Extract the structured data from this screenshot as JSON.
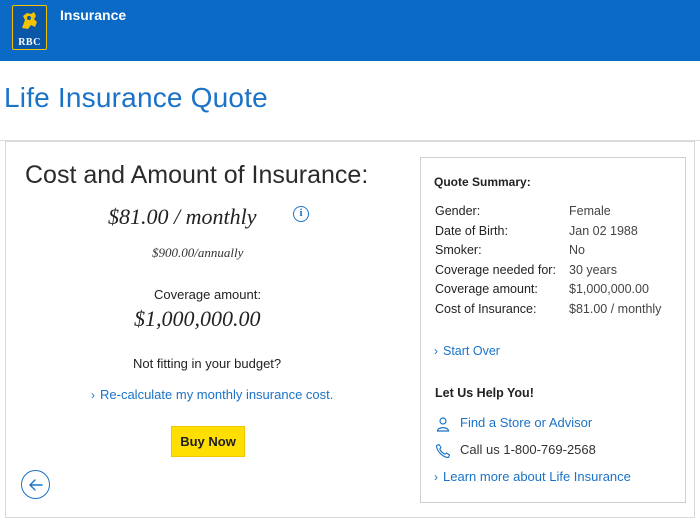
{
  "header": {
    "logo_text": "RBC",
    "nav_label": "Insurance",
    "bg_color": "#0a6ac6"
  },
  "page": {
    "title": "Life Insurance Quote"
  },
  "quote": {
    "heading": "Cost and Amount of Insurance:",
    "monthly_cost": "$81.00 / monthly",
    "info_icon_glyph": "i",
    "annual_cost": "$900.00/annually",
    "coverage_label": "Coverage amount:",
    "coverage_value": "$1,000,000.00",
    "budget_prompt": "Not fitting in your budget?",
    "recalc_link": "Re-calculate my monthly insurance cost.",
    "buy_button": "Buy Now",
    "back_icon": "arrow-left-circle-icon"
  },
  "summary": {
    "title": "Quote Summary:",
    "rows": [
      {
        "label": "Gender:",
        "value": "Female"
      },
      {
        "label": "Date of Birth:",
        "value": "Jan 02 1988"
      },
      {
        "label": "Smoker:",
        "value": "No"
      },
      {
        "label": "Coverage needed for:",
        "value": "30 years"
      },
      {
        "label": "Coverage amount:",
        "value": "$1,000,000.00"
      },
      {
        "label": "Cost of Insurance:",
        "value": "$81.00 / monthly"
      }
    ],
    "start_over": "Start Over",
    "help_title": "Let Us Help You!",
    "find_store": "Find a Store or Advisor",
    "call_text": "Call us 1-800-769-2568",
    "learn_more": "Learn more about Life Insurance"
  },
  "colors": {
    "link_blue": "#1a73c7",
    "button_yellow": "#fedf01"
  }
}
